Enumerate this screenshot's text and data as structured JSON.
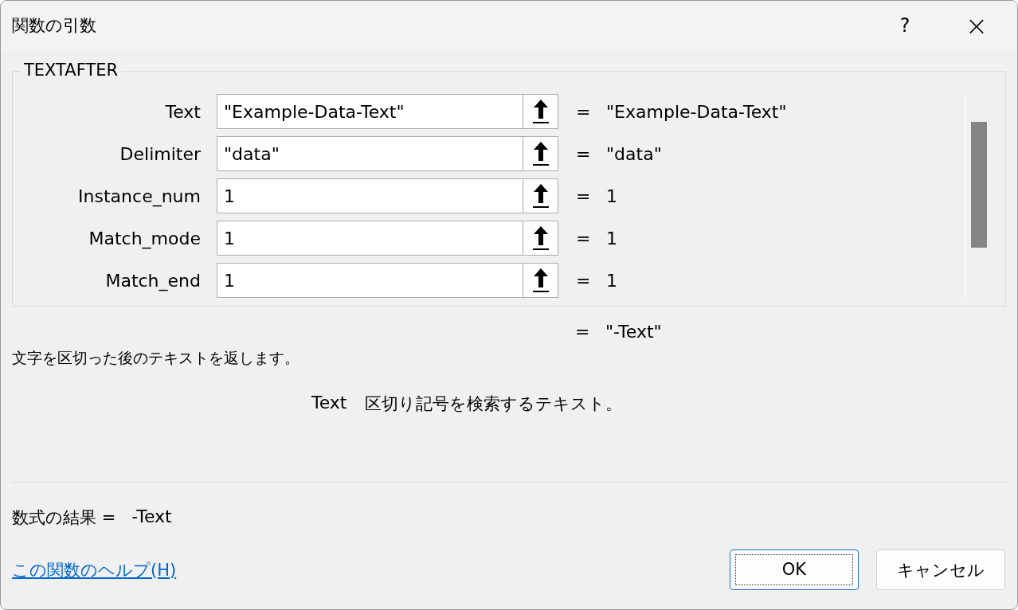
{
  "window": {
    "title": "関数の引数",
    "help": "?",
    "close": "×"
  },
  "function_name": "TEXTAFTER",
  "arguments": [
    {
      "label": "Text",
      "value": "\"Example-Data-Text\"",
      "equals": "=",
      "result": "\"Example-Data-Text\""
    },
    {
      "label": "Delimiter",
      "value": "\"data\"",
      "equals": "=",
      "result": "\"data\""
    },
    {
      "label": "Instance_num",
      "value": "1",
      "equals": "=",
      "result": "1"
    },
    {
      "label": "Match_mode",
      "value": "1",
      "equals": "=",
      "result": "1"
    },
    {
      "label": "Match_end",
      "value": "1",
      "equals": "=",
      "result": "1"
    }
  ],
  "function_result": {
    "equals": "=",
    "value": "\"-Text\""
  },
  "description": "文字を区切った後のテキストを返します。",
  "argument_help": {
    "name": "Text",
    "text": "区切り記号を検索するテキスト。"
  },
  "formula_result": {
    "label": "数式の結果 =",
    "value": "-Text"
  },
  "help_link": "この関数のヘルプ(H)",
  "buttons": [
    {
      "label": "OK",
      "default": true
    },
    {
      "label": "キャンセル",
      "default": false
    }
  ]
}
